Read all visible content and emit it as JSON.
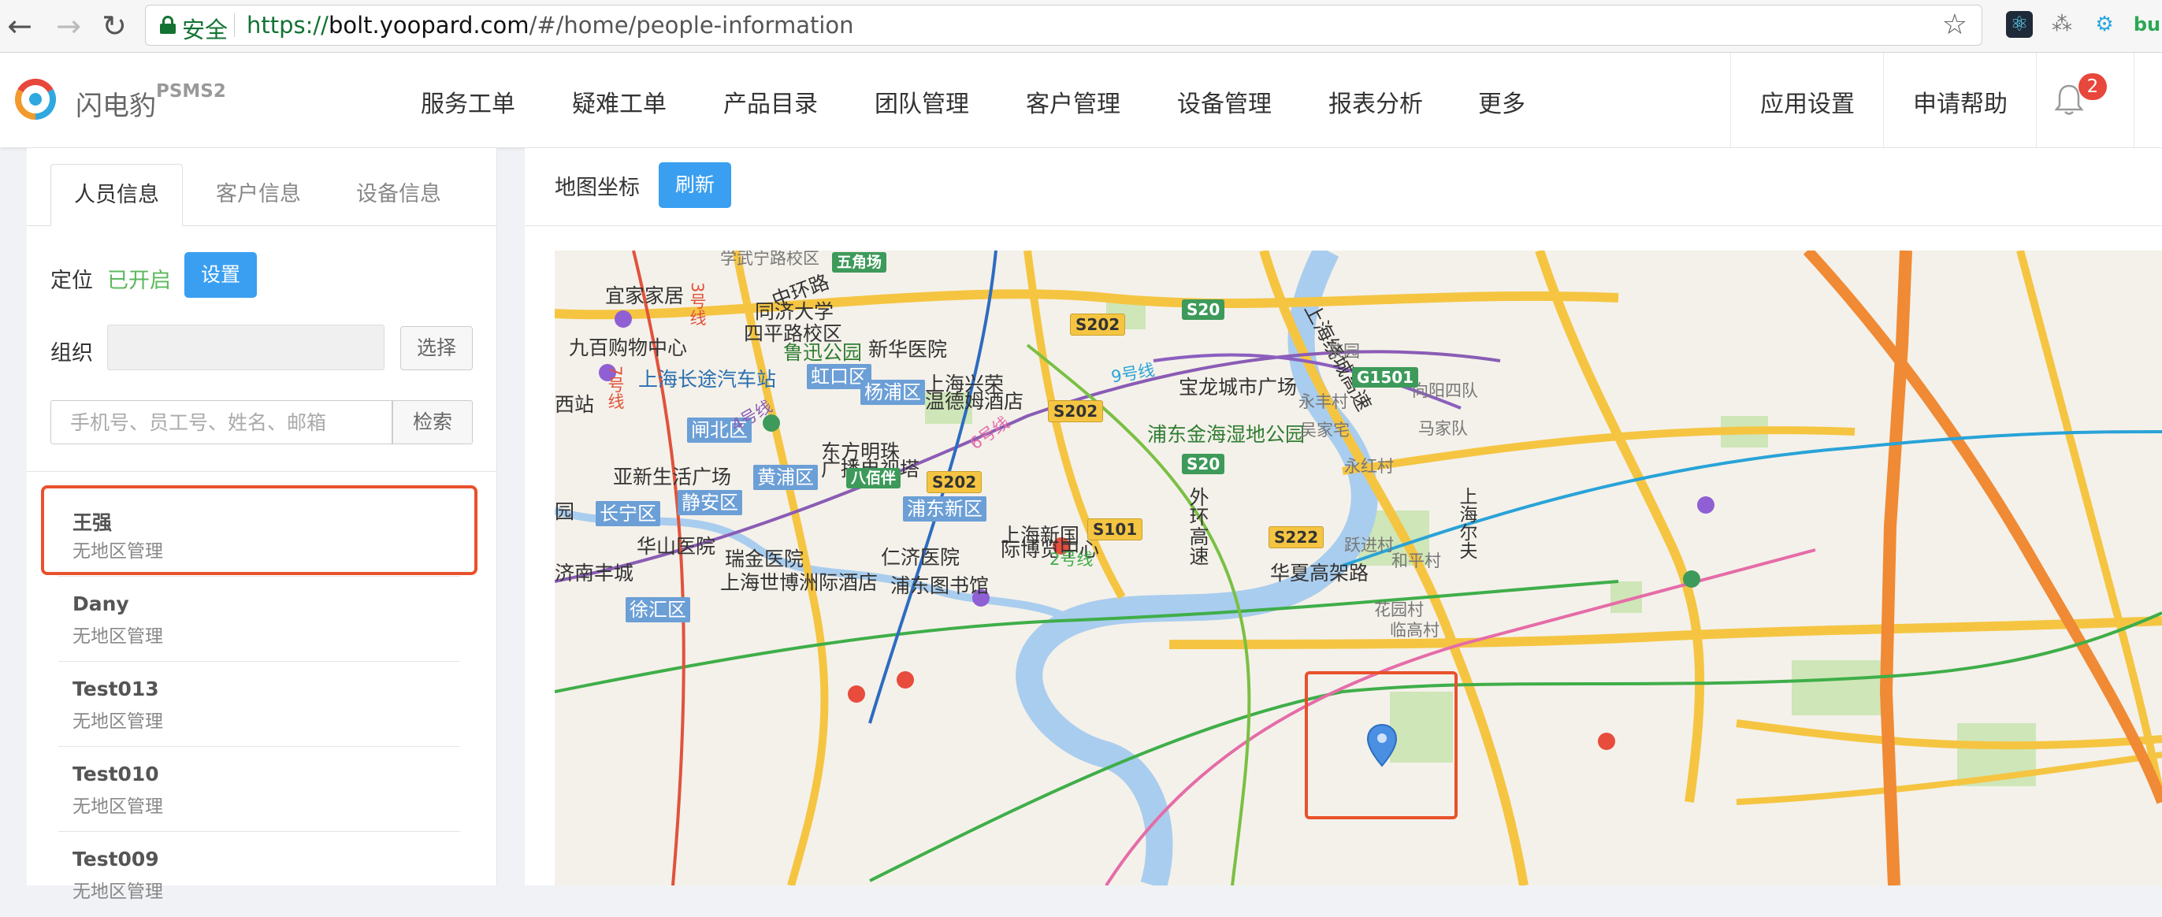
{
  "browser": {
    "secure_label": "安全",
    "url_scheme": "https://",
    "url_domain": "bolt.yoopard.com",
    "url_path": "/#/home/people-information",
    "extension_text": "bu"
  },
  "app": {
    "brand_name": "闪电豹",
    "brand_sub": "PSMS2",
    "nav": [
      "服务工单",
      "疑难工单",
      "产品目录",
      "团队管理",
      "客户管理",
      "设备管理",
      "报表分析",
      "更多"
    ],
    "settings_label": "应用设置",
    "help_label": "申请帮助",
    "notification_count": "2"
  },
  "left_panel": {
    "tabs": [
      "人员信息",
      "客户信息",
      "设备信息"
    ],
    "active_tab": 0,
    "location_label": "定位",
    "location_status": "已开启",
    "settings_button": "设置",
    "org_label": "组织",
    "org_value": "",
    "select_button": "选择",
    "search_placeholder": "手机号、员工号、姓名、邮箱",
    "search_button": "检索",
    "people": [
      {
        "name": "王强",
        "region": "无地区管理"
      },
      {
        "name": "Dany",
        "region": "无地区管理"
      },
      {
        "name": "Test013",
        "region": "无地区管理"
      },
      {
        "name": "Test010",
        "region": "无地区管理"
      },
      {
        "name": "Test009",
        "region": "无地区管理"
      }
    ]
  },
  "right_panel": {
    "title": "地图坐标",
    "refresh_button": "刷新"
  },
  "map": {
    "labels": {
      "yijia": "宜家家居",
      "tongji": "同济大学",
      "sipinglu": "四平路校区",
      "jiubai": "九百购物中心",
      "luxun": "鲁迅公园",
      "xinhua": "新华医院",
      "changtu": "上海长途汽车站",
      "hongkou": "虹口区",
      "yangpu": "杨浦区",
      "xingrong": "上海兴荣",
      "wendemu": "温德姆酒店",
      "zhabei": "闸北区",
      "xizhan": "西站",
      "dongfang1": "东方明珠",
      "dongfang2": "广播电视塔",
      "yaxin": "亚新生活广场",
      "huangpu": "黄浦区",
      "jingan": "静安区",
      "changning": "长宁区",
      "pudongxin": "浦东新区",
      "huashan": "华山医院",
      "ruijin": "瑞金医院",
      "renji": "仁济医院",
      "shibo_hotel": "上海世博洲际酒店",
      "pudong_lib": "浦东图书馆",
      "xuhui": "徐汇区",
      "jinanfeng": "济南丰城",
      "baolong": "宝龙城市广场",
      "jinhai": "浦东金海湿地公园",
      "huaxia": "华夏高架路",
      "expo1": "上海新国",
      "expo2": "际博览中心",
      "waihuan": "外环高速",
      "zhonghuan": "中环路",
      "shanghai_gaosu": "上海绕城高速",
      "wujiaochang": "五角场",
      "bafuzhuan": "八佰伴",
      "line9": "9号线",
      "line2": "2号线",
      "line6": "6号线",
      "line4": "4号线",
      "line7": "7号线",
      "line3": "3号线",
      "yongfeng": "永丰村",
      "wujia": "吴家宅",
      "yonghong": "永红村",
      "yuejin": "跃进村",
      "heping": "和平村",
      "xiangyang": "向阳四队",
      "majia": "马家队",
      "caiyuan": "茶园",
      "huayuan": "花园村",
      "lingao": "临高村",
      "ershan": "上海尔夫",
      "yuanqu": "园",
      "top_cut": "学武宁路校区"
    },
    "shields": {
      "s20a": "S20",
      "s20b": "S20",
      "s202a": "S202",
      "s202b": "S202",
      "s202c": "S202",
      "s101": "S101",
      "s222": "S222",
      "g1501": "G1501"
    }
  }
}
